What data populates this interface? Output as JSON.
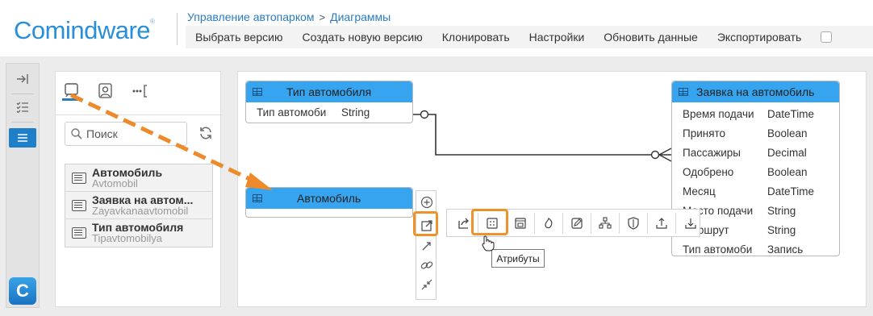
{
  "header": {
    "logo_text": "Comindware",
    "logo_mark": "®",
    "breadcrumb": {
      "parent": "Управление автопарком",
      "separator": ">",
      "current": "Диаграммы"
    },
    "toolbar": [
      {
        "label": "Выбрать версию",
        "name": "select-version-button"
      },
      {
        "label": "Создать новую версию",
        "name": "create-version-button"
      },
      {
        "label": "Клонировать",
        "name": "clone-button"
      },
      {
        "label": "Настройки",
        "name": "settings-button"
      },
      {
        "label": "Обновить данные",
        "name": "refresh-data-button"
      },
      {
        "label": "Экспортировать",
        "name": "export-button"
      }
    ]
  },
  "leftnav": {
    "items": [
      {
        "icon": "expand-panel-icon",
        "glyph": "⇥"
      },
      {
        "icon": "checklist-icon",
        "glyph": "☰"
      },
      {
        "icon": "list-icon",
        "glyph": "☰",
        "active": true
      }
    ],
    "app_icon_letter": "C"
  },
  "objects_panel": {
    "search_placeholder": "Поиск",
    "items": [
      {
        "title": "Автомобиль",
        "subtitle": "Avtomobil"
      },
      {
        "title": "Заявка на автом...",
        "subtitle": "Zayavkanaavtomobil"
      },
      {
        "title": "Тип автомобиля",
        "subtitle": "Tipavtomobilya"
      }
    ]
  },
  "diagram": {
    "entities": {
      "car_type": {
        "title": "Тип автомобиля",
        "attributes": [
          {
            "name": "Тип автомоби",
            "type": "String"
          }
        ]
      },
      "car": {
        "title": "Автомобиль",
        "attributes": []
      },
      "request": {
        "title": "Заявка на автомобиль",
        "attributes": [
          {
            "name": "Время подачи",
            "type": "DateTime"
          },
          {
            "name": "Принято",
            "type": "Boolean"
          },
          {
            "name": "Пассажиры",
            "type": "Decimal"
          },
          {
            "name": "Одобрено",
            "type": "Boolean"
          },
          {
            "name": "Месяц",
            "type": "DateTime"
          },
          {
            "name": "Место подачи",
            "type": "String"
          },
          {
            "name": "Маршрут",
            "type": "String"
          },
          {
            "name": "Тип автомоби",
            "type": "Запись"
          }
        ]
      }
    },
    "tooltip": "Атрибуты",
    "accent_color": "#36a4ee",
    "highlight_color": "#f0922b"
  }
}
